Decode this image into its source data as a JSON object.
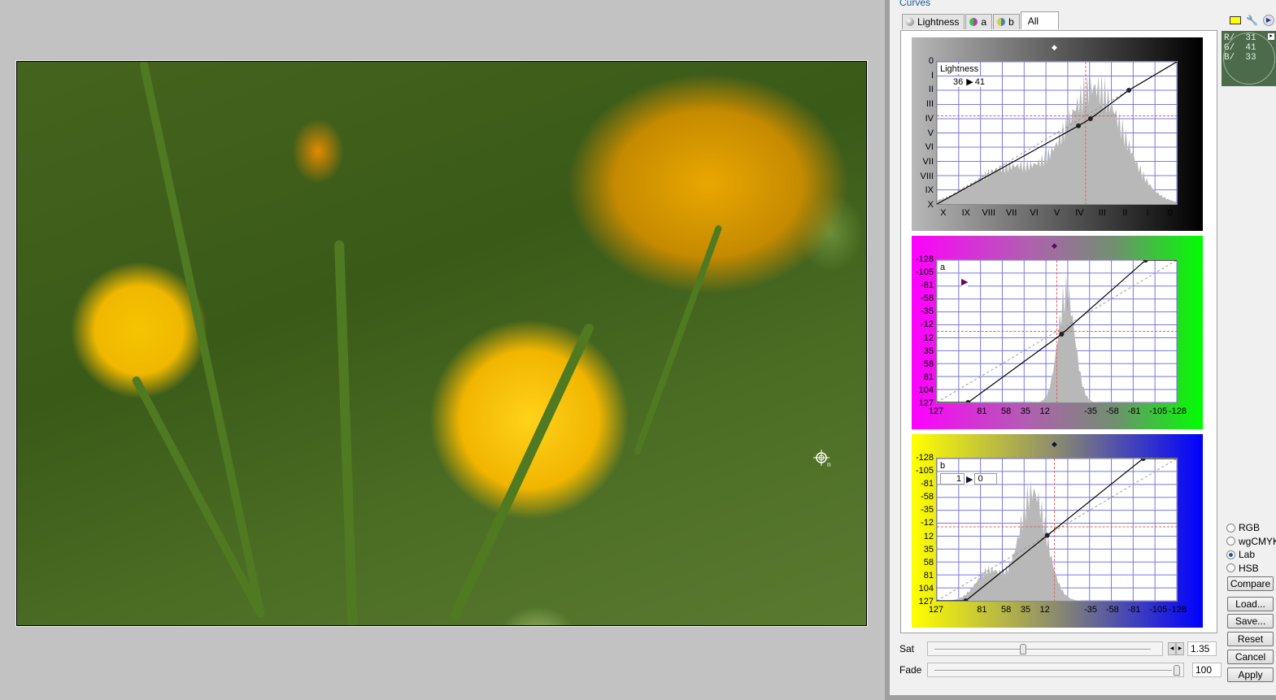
{
  "panel": {
    "title": "Curves",
    "tabs": [
      {
        "label": "Lightness",
        "icon": "lightness-channel-icon",
        "color": "#707070"
      },
      {
        "label": "a",
        "icon": "a-channel-icon",
        "color": "#b040b0"
      },
      {
        "label": "b",
        "icon": "b-channel-icon",
        "color": "#4080c0"
      },
      {
        "label": "All",
        "active": true
      }
    ],
    "top_icons": [
      "note-icon",
      "wrench-icon",
      "play-icon"
    ],
    "readout": {
      "r_label": "R/",
      "r": "31",
      "g_label": "G/",
      "g": "41",
      "b_label": "B/",
      "b": "33"
    },
    "curves": [
      {
        "name": "lightness",
        "label": "Lightness",
        "input_value": "36",
        "output_value": "41",
        "y_ticks": [
          "0",
          "I",
          "II",
          "III",
          "IV",
          "V",
          "VI",
          "VII",
          "VIII",
          "IX",
          "X"
        ],
        "x_ticks": [
          "X",
          "IX",
          "VIII",
          "VII",
          "VI",
          "V",
          "IV",
          "III",
          "II",
          "I",
          "0"
        ],
        "gradient": [
          "#a0a0a0",
          "#000000"
        ],
        "curve_points": [
          [
            0,
            0
          ],
          [
            0.59,
            0.55
          ],
          [
            0.64,
            0.6
          ],
          [
            0.8,
            0.8
          ],
          [
            1,
            1
          ]
        ]
      },
      {
        "name": "a",
        "label": "a",
        "y_ticks": [
          "-128",
          "-105",
          "-81",
          "-58",
          "-35",
          "-12",
          "12",
          "35",
          "58",
          "81",
          "104",
          "127"
        ],
        "x_ticks": [
          "127",
          "81",
          "58",
          "35",
          "12",
          "-35",
          "-58",
          "-81",
          "-105",
          "-128"
        ],
        "gradient": [
          "#ff00ff",
          "#00ff00"
        ],
        "curve_points": [
          [
            0,
            0
          ],
          [
            0.13,
            0
          ],
          [
            0.52,
            0.48
          ],
          [
            0.87,
            1
          ],
          [
            1,
            1
          ]
        ]
      },
      {
        "name": "b",
        "label": "b",
        "input_value": "1",
        "output_value": "0",
        "y_ticks": [
          "-128",
          "-105",
          "-81",
          "-58",
          "-35",
          "-12",
          "12",
          "35",
          "58",
          "81",
          "104",
          "127"
        ],
        "x_ticks": [
          "127",
          "81",
          "58",
          "35",
          "12",
          "-35",
          "-58",
          "-81",
          "-105",
          "-128"
        ],
        "gradient": [
          "#ffff00",
          "#0000ff"
        ],
        "curve_points": [
          [
            0,
            0
          ],
          [
            0.12,
            0
          ],
          [
            0.46,
            0.46
          ],
          [
            0.86,
            1
          ],
          [
            1,
            1
          ]
        ]
      }
    ],
    "color_modes": [
      {
        "label": "RGB",
        "selected": false
      },
      {
        "label": "wgCMYK",
        "selected": false
      },
      {
        "label": "Lab",
        "selected": true
      },
      {
        "label": "HSB",
        "selected": false
      }
    ],
    "buttons": {
      "compare": "Compare",
      "load": "Load...",
      "save": "Save...",
      "reset": "Reset",
      "cancel": "Cancel",
      "apply": "Apply"
    },
    "sat": {
      "label": "Sat",
      "value": "1.35",
      "fraction": 0.39
    },
    "fade": {
      "label": "Fade",
      "value": "100",
      "fraction": 1.0
    }
  },
  "preview": {
    "cursor": "eyedropper-crosshair-icon",
    "cursor_suffix": "n"
  }
}
